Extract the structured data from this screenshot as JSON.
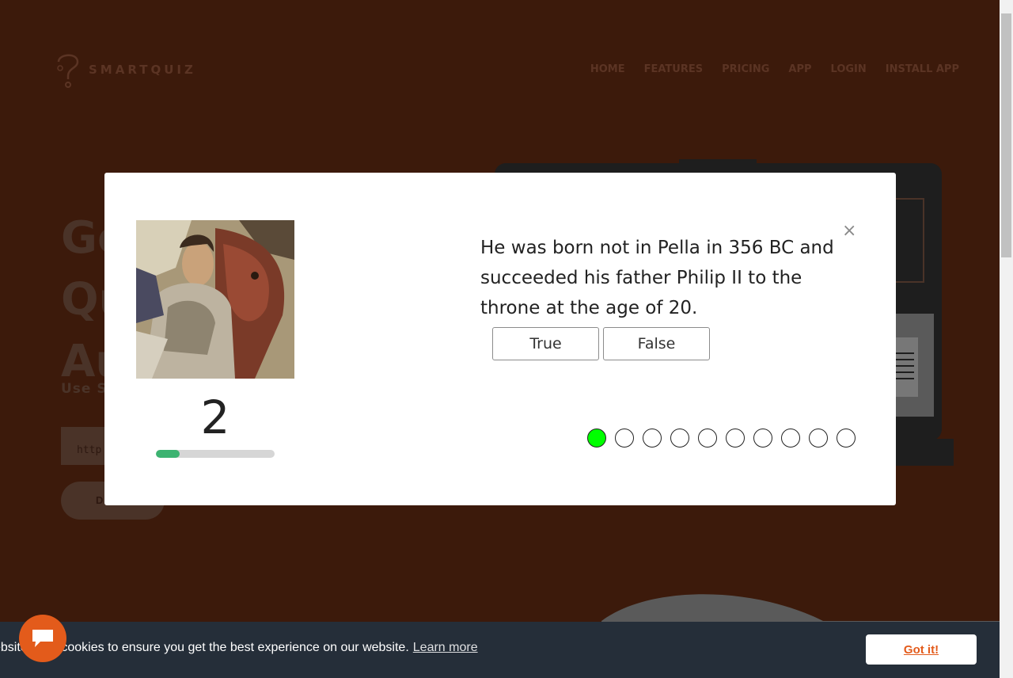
{
  "brand": {
    "name": "SMARTQUIZ"
  },
  "nav": {
    "items": [
      "HOME",
      "FEATURES",
      "PRICING",
      "APP",
      "LOGIN",
      "INSTALL APP"
    ]
  },
  "hero": {
    "title_fragment": "Ge\nQu\nAu",
    "subtitle_fragment": "Use Sm",
    "input_fragment": "http",
    "button_fragment": "D"
  },
  "modal": {
    "question": "He was born not in Pella in 356 BC and succeeded his father Philip II to the throne at the age of 20.",
    "close_label": "×",
    "answers": {
      "true_label": "True",
      "false_label": "False"
    },
    "counter": "2",
    "timer_progress": 0.2,
    "progress_dots": {
      "total": 10,
      "current": 1
    },
    "colors": {
      "active_dot": "#00ff00",
      "timer_fill": "#3cb371"
    }
  },
  "cookie": {
    "message": "ebsite uses cookies to ensure you get the best experience on our website.",
    "learn_more": "Learn more",
    "accept_label": "Got it!"
  },
  "icons": {
    "chat": "chat-bubble-icon",
    "close": "close-icon",
    "logo": "question-mark-logo-icon"
  },
  "colors": {
    "background": "#3c1a0b",
    "accent": "#e35b1b",
    "cookie_bar": "#252e39"
  }
}
